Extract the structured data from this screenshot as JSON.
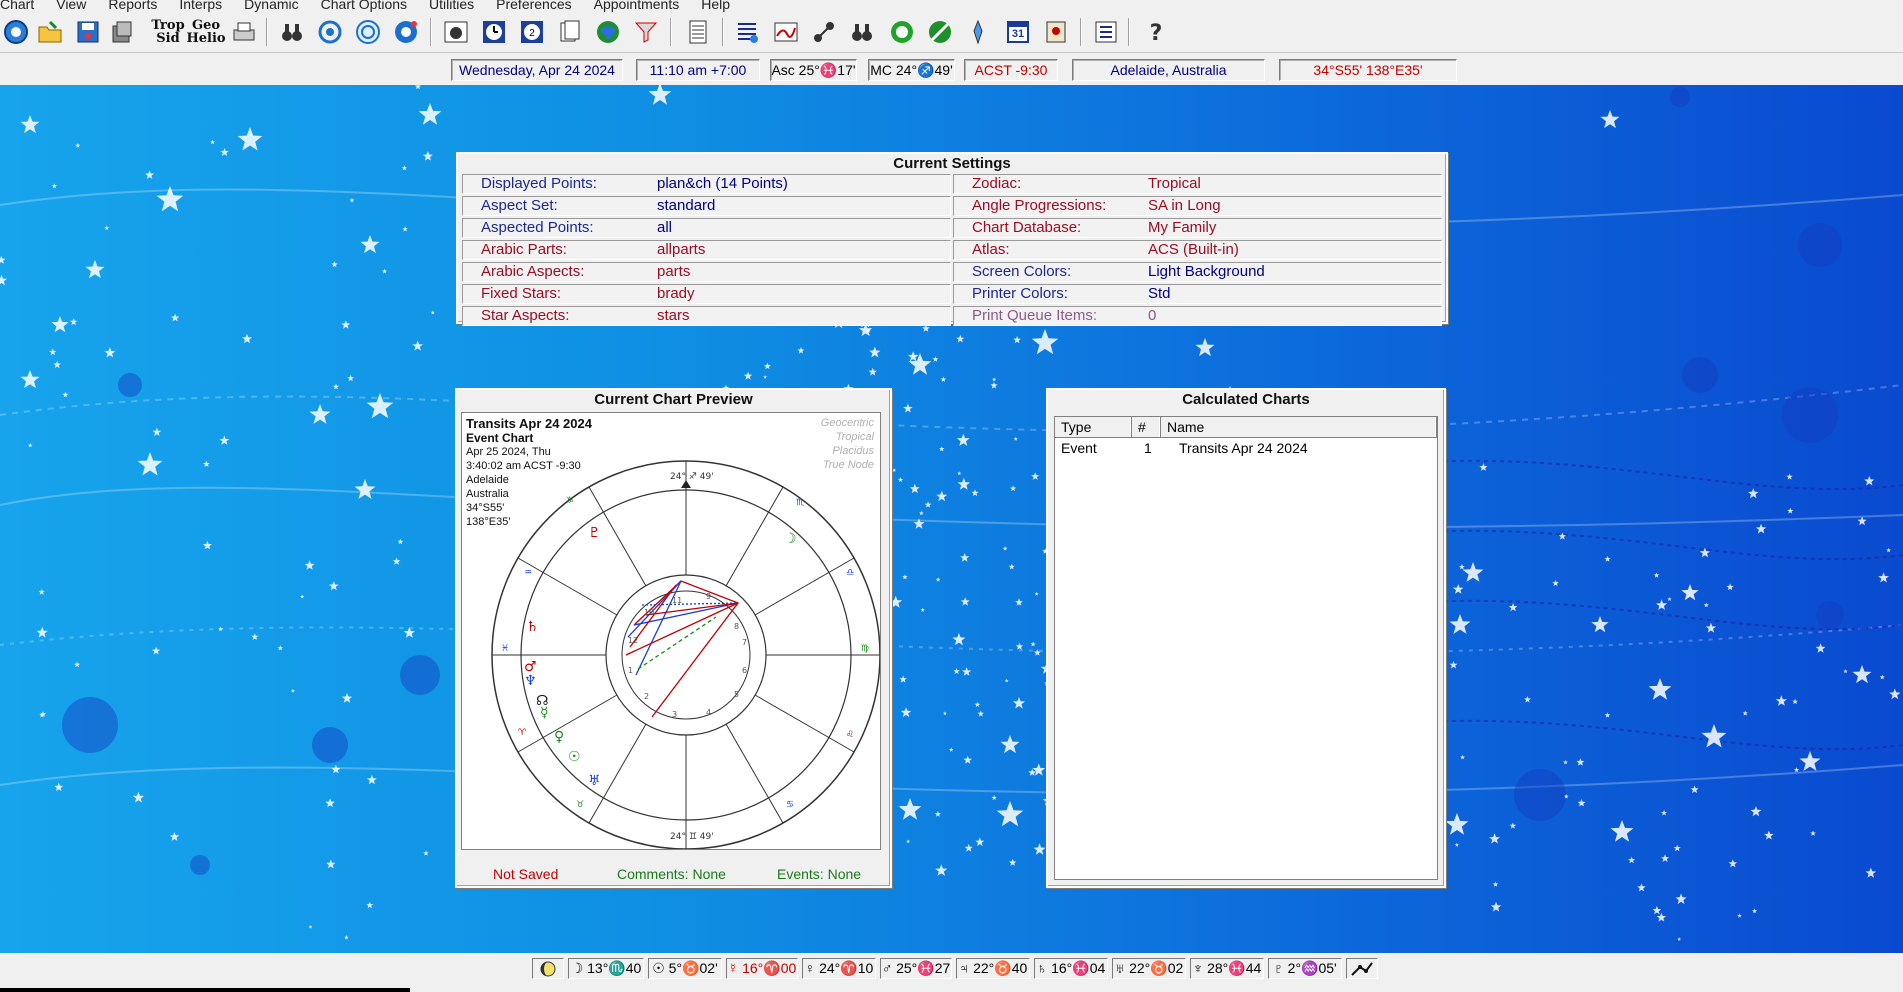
{
  "menu": [
    "Chart",
    "View",
    "Reports",
    "Interps",
    "Dynamic",
    "Chart Options",
    "Utilities",
    "Preferences",
    "Appointments",
    "Help"
  ],
  "toolbar": {
    "trop_sid": [
      "Trop",
      "Sid"
    ],
    "geo_helio": [
      "Geo",
      "Helio"
    ],
    "calendar_day": "31"
  },
  "infobar": {
    "date": "Wednesday, Apr 24 2024",
    "time": "11:10 am  +7:00",
    "asc": "Asc 25°♓17'",
    "mc": "MC 24°♐49'",
    "tz": "ACST -9:30",
    "place": "Adelaide, Australia",
    "coords": "34°S55'  138°E35'"
  },
  "settings": {
    "title": "Current Settings",
    "left": [
      {
        "label": "Displayed Points:",
        "value": "plan&ch  (14 Points)"
      },
      {
        "label": "Aspect Set:",
        "value": "standard"
      },
      {
        "label": "Aspected Points:",
        "value": "all"
      },
      {
        "label": "Arabic Parts:",
        "value": "allparts"
      },
      {
        "label": "Arabic Aspects:",
        "value": "parts"
      },
      {
        "label": "Fixed Stars:",
        "value": "brady"
      },
      {
        "label": "Star Aspects:",
        "value": "stars"
      }
    ],
    "right": [
      {
        "label": "Zodiac:",
        "value": "Tropical"
      },
      {
        "label": "Angle Progressions:",
        "value": "SA in Long"
      },
      {
        "label": "Chart Database:",
        "value": "My Family"
      },
      {
        "label": "Atlas:",
        "value": "ACS  (Built-in)"
      },
      {
        "label": "Screen Colors:",
        "value": "Light Background"
      },
      {
        "label": "Printer Colors:",
        "value": "Std"
      },
      {
        "label": "Print Queue Items:",
        "value": "0"
      }
    ]
  },
  "preview": {
    "title": "Current Chart Preview",
    "chart_name": "Transits Apr 24 2024",
    "chart_type": "Event Chart",
    "lines": [
      "Apr 25 2024, Thu",
      "3:40:02 am  ACST -9:30",
      "Adelaide",
      "Australia",
      "34°S55'",
      "138°E35'"
    ],
    "right": [
      "Geocentric",
      "Tropical",
      "Placidus",
      "True Node"
    ],
    "top_degree": "24° ♐ 49'",
    "bottom_degree": "24° ♊ 49'",
    "not_saved": "Not Saved",
    "comments": "Comments: None",
    "events": "Events: None"
  },
  "calculated": {
    "title": "Calculated Charts",
    "columns": [
      "Type",
      "#",
      "Name"
    ],
    "rows": [
      {
        "type": "Event",
        "num": "1",
        "name": "Transits Apr 24 2024"
      }
    ]
  },
  "status": [
    "☽ 13°♏40",
    "☉ 5°♉02'",
    "☿ 16°♈00",
    "♀ 24°♈10",
    "♂ 25°♓27",
    "♃ 22°♉40",
    "♄ 16°♓04",
    "♅ 22°♉02",
    "♆ 28°♓44",
    "♇ 2°♒05'"
  ],
  "colors": {
    "title_red": "#c00000",
    "navy": "#000080",
    "desktop_left": "#17a4ec",
    "desktop_right": "#0a4ad0"
  }
}
